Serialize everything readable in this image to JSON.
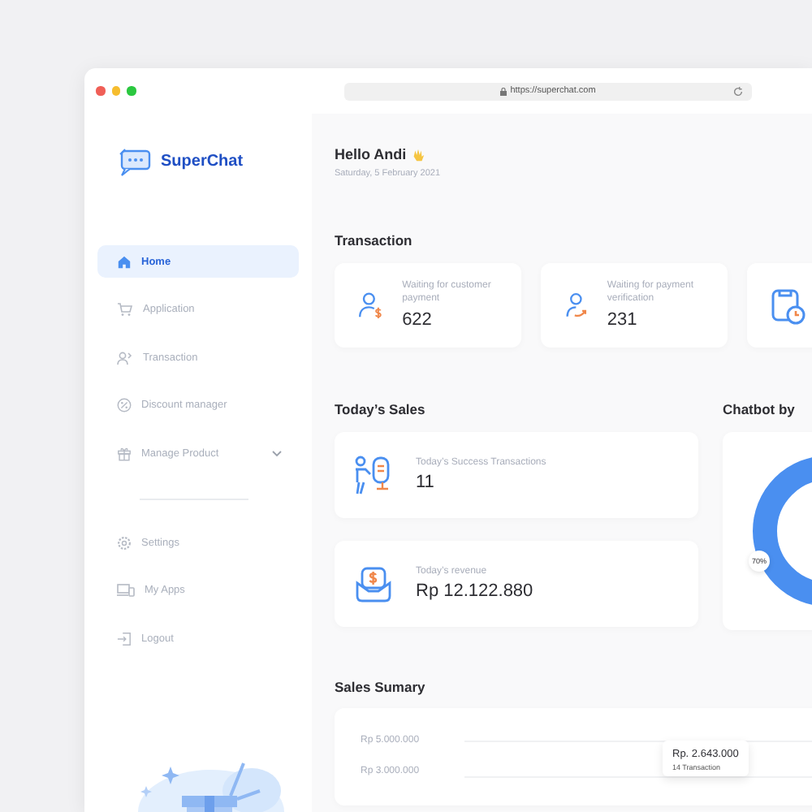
{
  "browser": {
    "url": "https://superchat.com"
  },
  "brand": {
    "name": "SuperChat"
  },
  "nav": [
    {
      "label": "Home",
      "selected": true,
      "kind": "link"
    },
    {
      "label": "Application",
      "selected": false,
      "kind": "link"
    },
    {
      "label": "Transaction",
      "selected": false,
      "kind": "link"
    },
    {
      "label": "Discount manager",
      "selected": false,
      "kind": "link"
    },
    {
      "label": "Manage Product",
      "selected": false,
      "kind": "group"
    }
  ],
  "nav_secondary": [
    {
      "label": "Settings",
      "selected": false
    },
    {
      "label": "My Apps",
      "selected": false
    },
    {
      "label": "Logout",
      "selected": false
    }
  ],
  "greeting": {
    "title": "Hello Andi",
    "date": "Saturday, 5 February 2021"
  },
  "transaction": {
    "title": "Transaction",
    "cards": [
      {
        "kind": "stat",
        "label": "Waiting for customer payment",
        "value": "622"
      },
      {
        "kind": "stat",
        "label": "Waiting for payment verification",
        "value": "231"
      },
      {
        "kind": "partial"
      }
    ]
  },
  "sales": {
    "title": "Today’s Sales",
    "cards": [
      {
        "label": "Today’s Success Transactions",
        "value": "11"
      },
      {
        "label": "Today’s revenue",
        "value": "Rp 12.122.880"
      }
    ]
  },
  "chatbot": {
    "title": "Chatbot by",
    "share_label": "70%"
  },
  "summary": {
    "title": "Sales Sumary",
    "axis_labels": [
      "Rp 5.000.000",
      "Rp 3.000.000"
    ],
    "tooltip": {
      "amount": "Rp. 2.643.000",
      "count": "14 Transaction"
    }
  }
}
